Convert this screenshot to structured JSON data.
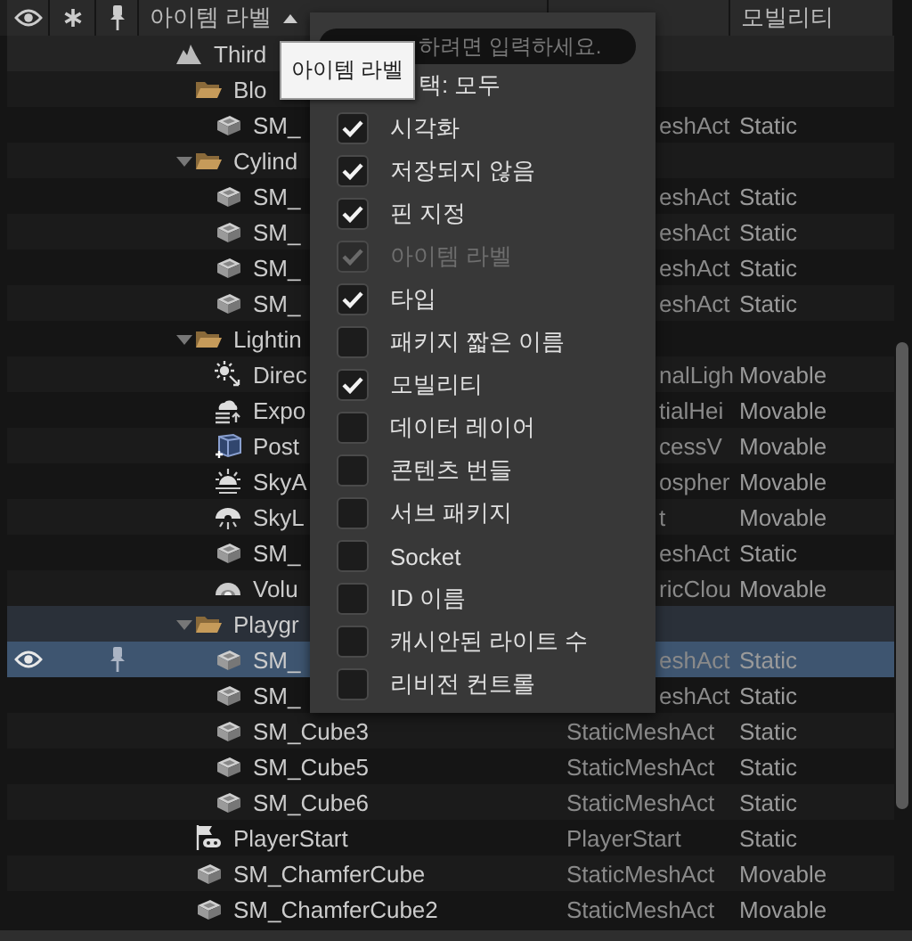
{
  "header": {
    "columns": [
      {
        "kind": "visibility"
      },
      {
        "kind": "favorite"
      },
      {
        "kind": "pin"
      },
      {
        "kind": "label",
        "label": "아이템 라벨",
        "sorted": true
      },
      {
        "kind": "text"
      },
      {
        "kind": "text",
        "label": "모빌리티"
      }
    ]
  },
  "tree": [
    {
      "label": "Third",
      "kind": "world",
      "selected": false,
      "children": [
        {
          "label": "Blo",
          "kind": "folder",
          "selected": false,
          "children": [
            {
              "label": "SM_",
              "kind": "mesh",
              "type": "eshAct",
              "mobility": "Static",
              "selected": false
            }
          ]
        },
        {
          "label": "Cylind",
          "kind": "folder",
          "selected": false,
          "expanded": true,
          "children": [
            {
              "label": "SM_",
              "kind": "mesh",
              "type": "eshAct",
              "mobility": "Static",
              "selected": false
            },
            {
              "label": "SM_",
              "kind": "mesh",
              "type": "eshAct",
              "mobility": "Static",
              "selected": false
            },
            {
              "label": "SM_",
              "kind": "mesh",
              "type": "eshAct",
              "mobility": "Static",
              "selected": false
            },
            {
              "label": "SM_",
              "kind": "mesh",
              "type": "eshAct",
              "mobility": "Static",
              "selected": false
            }
          ]
        },
        {
          "label": "Lightin",
          "kind": "folder",
          "selected": false,
          "expanded": true,
          "children": [
            {
              "label": "Direc",
              "kind": "sun",
              "type": "nalLigh",
              "mobility": "Movable",
              "selected": false
            },
            {
              "label": "Expo",
              "kind": "fog",
              "type": "tialHei",
              "mobility": "Movable",
              "selected": false
            },
            {
              "label": "Post",
              "kind": "volume",
              "type": "cessV",
              "mobility": "Movable",
              "selected": false
            },
            {
              "label": "SkyA",
              "kind": "atmosphere",
              "type": "ospher",
              "mobility": "Movable",
              "selected": false
            },
            {
              "label": "SkyL",
              "kind": "skylight",
              "type": "t",
              "mobility": "Movable",
              "selected": false
            },
            {
              "label": "SM_",
              "kind": "mesh",
              "type": "eshAct",
              "mobility": "Static",
              "selected": false
            },
            {
              "label": "Volu",
              "kind": "cloud",
              "type": "ricClou",
              "mobility": "Movable",
              "selected": false
            }
          ]
        },
        {
          "label": "Playgr",
          "kind": "folder",
          "selected": false,
          "expanded": true,
          "children": [
            {
              "label": "SM_",
              "kind": "mesh",
              "type": "eshAct",
              "mobility": "Static",
              "selected": true
            },
            {
              "label": "SM_",
              "kind": "mesh",
              "type": "eshAct",
              "mobility": "Static",
              "selected": false
            },
            {
              "label": "SM_Cube3",
              "kind": "mesh",
              "type": "StaticMeshAct",
              "mobility": "Static",
              "selected": false
            },
            {
              "label": "SM_Cube5",
              "kind": "mesh",
              "type": "StaticMeshAct",
              "mobility": "Static",
              "selected": false
            },
            {
              "label": "SM_Cube6",
              "kind": "mesh",
              "type": "StaticMeshAct",
              "mobility": "Static",
              "selected": false
            }
          ]
        },
        {
          "label": "PlayerStart",
          "kind": "player",
          "type": "PlayerStart",
          "mobility": "Static",
          "selected": false
        },
        {
          "label": "SM_ChamferCube",
          "kind": "mesh",
          "type": "StaticMeshAct",
          "mobility": "Movable",
          "selected": false
        },
        {
          "label": "SM_ChamferCube2",
          "kind": "mesh",
          "type": "StaticMeshAct",
          "mobility": "Movable",
          "selected": false
        }
      ]
    }
  ],
  "menu": {
    "search": {
      "placeholder": "하려면 입력하세요."
    },
    "items": [
      {
        "kind": "label",
        "label": "택: 모두"
      },
      {
        "kind": "checkbox",
        "label": "시각화",
        "checked": true,
        "disabled": false
      },
      {
        "kind": "checkbox",
        "label": "저장되지 않음",
        "checked": true,
        "disabled": false
      },
      {
        "kind": "checkbox",
        "label": "핀 지정",
        "checked": true,
        "disabled": false
      },
      {
        "kind": "checkbox",
        "label": "아이템 라벨",
        "checked": true,
        "disabled": true
      },
      {
        "kind": "checkbox",
        "label": "타입",
        "checked": true,
        "disabled": false
      },
      {
        "kind": "checkbox",
        "label": "패키지 짧은 이름",
        "checked": false,
        "disabled": false
      },
      {
        "kind": "checkbox",
        "label": "모빌리티",
        "checked": true,
        "disabled": false
      },
      {
        "kind": "checkbox",
        "label": "데이터 레이어",
        "checked": false,
        "disabled": false
      },
      {
        "kind": "checkbox",
        "label": "콘텐츠 번들",
        "checked": false,
        "disabled": false
      },
      {
        "kind": "checkbox",
        "label": "서브 패키지",
        "checked": false,
        "disabled": false
      },
      {
        "kind": "checkbox",
        "label": "Socket",
        "checked": false,
        "disabled": false
      },
      {
        "kind": "checkbox",
        "label": "ID 이름",
        "checked": false,
        "disabled": false
      },
      {
        "kind": "checkbox",
        "label": "캐시안된 라이트 수",
        "checked": false,
        "disabled": false
      },
      {
        "kind": "checkbox",
        "label": "리비전 컨트롤",
        "checked": false,
        "disabled": false
      }
    ]
  },
  "tooltip": {
    "text": "아이템 라벨"
  }
}
